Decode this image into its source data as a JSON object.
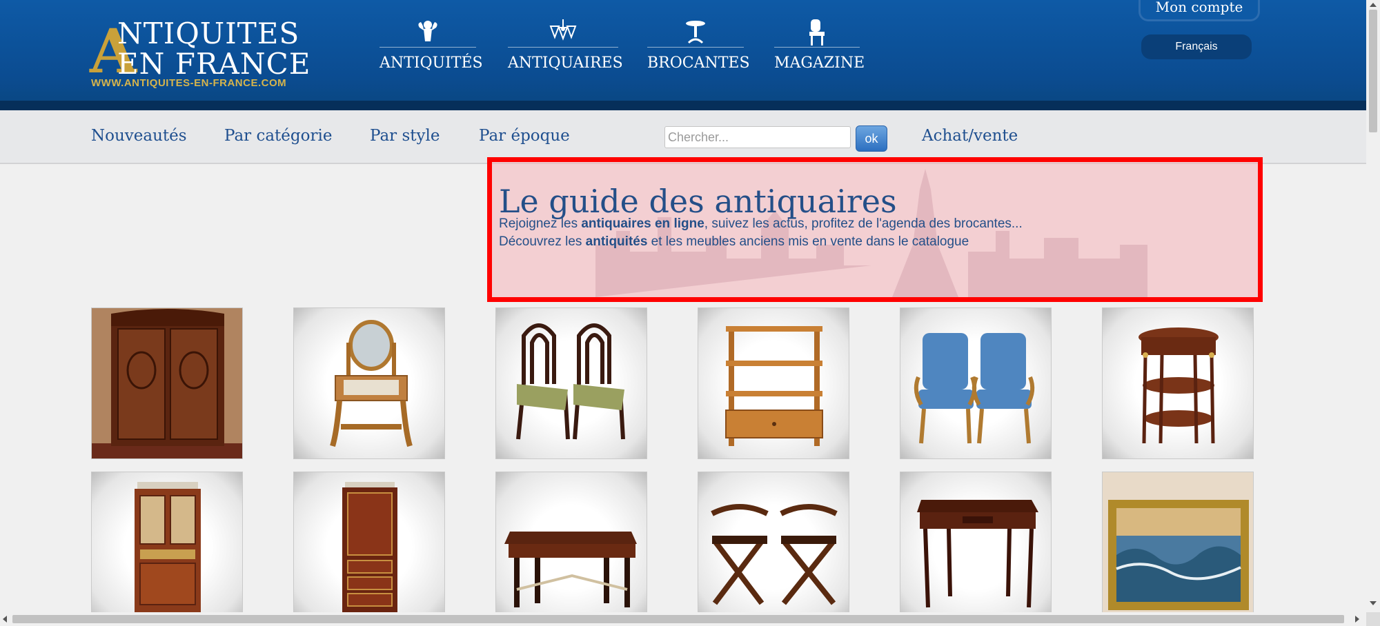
{
  "header": {
    "logo": {
      "line1": "NTIQUITES",
      "line2": "EN FRANCE",
      "big_letter": "A",
      "url": "WWW.ANTIQUITES-EN-FRANCE.COM"
    },
    "main_nav": [
      {
        "label": "ANTIQUITÉS",
        "icon": "cherub-icon"
      },
      {
        "label": "ANTIQUAIRES",
        "icon": "chandelier-icon"
      },
      {
        "label": "BROCANTES",
        "icon": "pedestal-table-icon"
      },
      {
        "label": "MAGAZINE",
        "icon": "chair-icon"
      }
    ],
    "account_label": "Mon compte",
    "language_label": "Français"
  },
  "subnav": {
    "links": [
      "Nouveautés",
      "Par catégorie",
      "Par style",
      "Par époque"
    ],
    "search_placeholder": "Chercher...",
    "search_button": "ok",
    "buy_sell": "Achat/vente"
  },
  "hero": {
    "title": "Le guide des antiquaires",
    "line1": {
      "pre": "Rejoignez les ",
      "bold": "antiquaires en ligne",
      "post": ", suivez les actus, profitez de l'agenda des brocantes..."
    },
    "line2": {
      "pre": "Découvrez les ",
      "bold": "antiquités",
      "post": " et les meubles anciens mis en vente dans le catalogue"
    }
  },
  "products": [
    "armoire",
    "dressing-table",
    "pair-of-chairs",
    "shelf-unit",
    "pair-of-armchairs",
    "gueridon",
    "display-cabinet",
    "secretary",
    "table",
    "pair-of-x-chairs",
    "desk",
    "seascape-painting"
  ]
}
